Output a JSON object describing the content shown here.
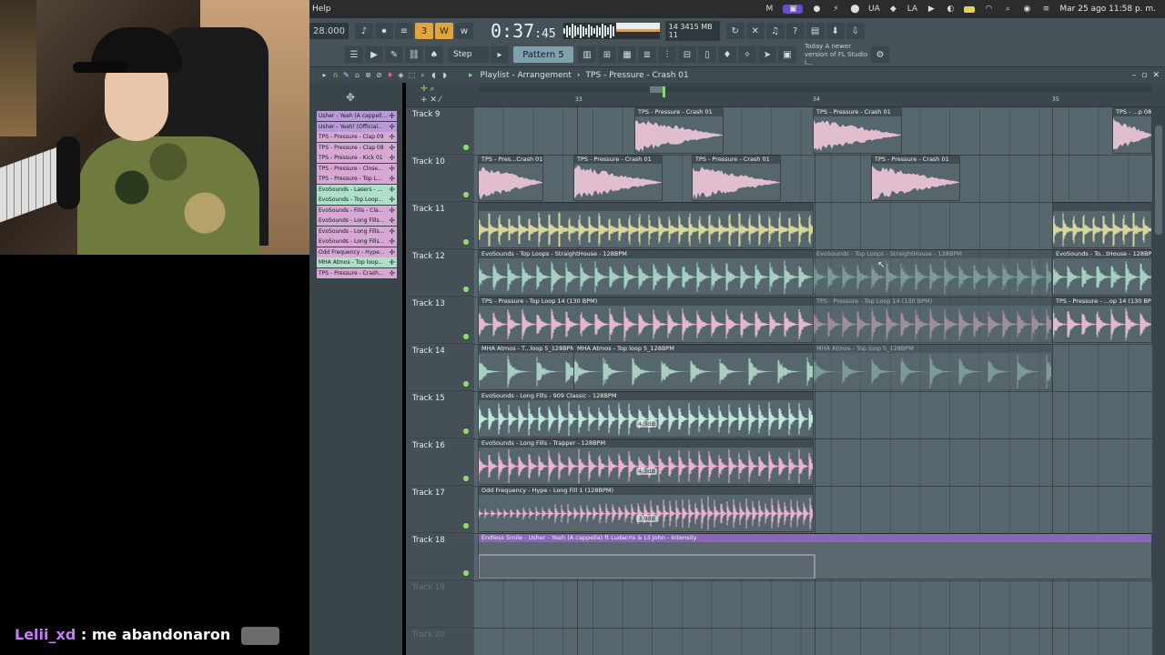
{
  "chat": {
    "user": "Lelii_xd",
    "message": ": me abandonaron"
  },
  "menubar": {
    "app_menu": "Help",
    "status_icons": [
      "M",
      "⚡",
      "●",
      "⬤",
      "UA",
      "◆",
      "LA",
      "▶",
      "◐",
      "▬",
      "wifi",
      "🔍",
      "◉",
      "≡"
    ],
    "clock": "Mar 25 ago  11:58 p. m."
  },
  "toolbar": {
    "tempo": "28.000",
    "time_main": "0:37",
    "time_sub": ":45",
    "time_unit": "M:S:CS",
    "cpu_line1": "14   3415 MB",
    "cpu_line2": "11",
    "snap_label": "Step",
    "pattern_label": "Pattern 5",
    "hint_line1": "Today  A newer",
    "hint_line2": "version of FL Studio i..."
  },
  "playlist": {
    "title": "Playlist - Arrangement",
    "separator": "›",
    "selected_clip": "TPS - Pressure - Crash 01",
    "ruler_numbers": [
      "33",
      "34",
      "35"
    ]
  },
  "picker_items": [
    {
      "label": "Usher - Yeah (A cappell...",
      "color": "#b89bd6"
    },
    {
      "label": "Usher - Yeah! (Official...",
      "color": "#b89bd6"
    },
    {
      "label": "TPS - Pressure - Clap 09",
      "color": "#d7a8d3"
    },
    {
      "label": "TPS - Pressure - Clap 08",
      "color": "#d7a8d3"
    },
    {
      "label": "TPS - Pressure - Kick 01",
      "color": "#d7a8d3"
    },
    {
      "label": "TPS - Pressure - Close...",
      "color": "#d7a8d3"
    },
    {
      "label": "TPS - Pressure - Top L...",
      "color": "#d7a8d3"
    },
    {
      "label": "EvoSounds - Lasers - ...",
      "color": "#aee0c9"
    },
    {
      "label": "EvoSounds - Top Loop...",
      "color": "#aee0c9"
    },
    {
      "label": "EvoSounds - Fills - Cla...",
      "color": "#d7a8d3"
    },
    {
      "label": "EvoSounds - Long Fills...",
      "color": "#d7a8d3"
    },
    {
      "label": "EvoSounds - Long Fills...",
      "color": "#d7a8d3"
    },
    {
      "label": "EvoSounds - Long Fills...",
      "color": "#d7a8d3"
    },
    {
      "label": "Odd Frequency - Hype...",
      "color": "#d7a8d3"
    },
    {
      "label": "MHA Atmos - Top loop...",
      "color": "#aee0c9"
    },
    {
      "label": "TPS - Pressure - Crash...",
      "color": "#d7a8d3"
    }
  ],
  "tracks": [
    {
      "name": "Track 9",
      "dim": false
    },
    {
      "name": "Track 10",
      "dim": false
    },
    {
      "name": "Track 11",
      "dim": false
    },
    {
      "name": "Track 12",
      "dim": false
    },
    {
      "name": "Track 13",
      "dim": false
    },
    {
      "name": "Track 14",
      "dim": false
    },
    {
      "name": "Track 15",
      "dim": false
    },
    {
      "name": "Track 16",
      "dim": false
    },
    {
      "name": "Track 17",
      "dim": false
    },
    {
      "name": "Track 18",
      "dim": false
    },
    {
      "name": "Track 19",
      "dim": true
    },
    {
      "name": "Track 20",
      "dim": true
    }
  ],
  "clips": [
    {
      "label": "TPS - Pressure - Crash 01",
      "color": "#e9c3d4",
      "style": "crash",
      "ghost": false,
      "db": ""
    },
    {
      "label": "TPS - Pressure - Crash 01",
      "color": "#e9c3d4",
      "style": "crash",
      "ghost": false,
      "db": ""
    },
    {
      "label": "TPS - ...p 08",
      "color": "#e9c3d4",
      "style": "crash",
      "ghost": false,
      "db": ""
    },
    {
      "label": "TPS - Pres...Crash 01",
      "color": "#e9c3d4",
      "style": "crash",
      "ghost": false,
      "db": ""
    },
    {
      "label": "TPS - Pressure - Crash 01",
      "color": "#e9c3d4",
      "style": "crash",
      "ghost": false,
      "db": ""
    },
    {
      "label": "TPS - Pressure - Crash 01",
      "color": "#e9c3d4",
      "style": "crash",
      "ghost": false,
      "db": ""
    },
    {
      "label": "TPS - Pressure - Crash 01",
      "color": "#e9c3d4",
      "style": "crash",
      "ghost": false,
      "db": ""
    },
    {
      "label": "",
      "color": "#d6d59a",
      "style": "dense-light",
      "ghost": false,
      "db": ""
    },
    {
      "label": "",
      "color": "#d6d59a",
      "style": "dense-light",
      "ghost": false,
      "db": ""
    },
    {
      "label": "EvoSounds - Top Loops - StraightHouse - 128BPM",
      "color": "#a7cfc0",
      "style": "loop",
      "ghost": false,
      "db": ""
    },
    {
      "label": "EvoSounds - Top Loops - StraightHouse - 128BPM",
      "color": "#a7cfc0",
      "style": "loop",
      "ghost": true,
      "db": ""
    },
    {
      "label": "EvoSounds - To...tHouse - 128BPM",
      "color": "#a7cfc0",
      "style": "loop",
      "ghost": false,
      "db": ""
    },
    {
      "label": "TPS - Pressure - Top Loop 14 (130 BPM)",
      "color": "#e3b9c9",
      "style": "loop",
      "ghost": false,
      "db": ""
    },
    {
      "label": "TPS - Pressure - Top Loop 14 (130 BPM)",
      "color": "#e3b9c9",
      "style": "loop",
      "ghost": true,
      "db": ""
    },
    {
      "label": "TPS - Pressure - ...op 14 (130 BPM)",
      "color": "#e3b9c9",
      "style": "loop",
      "ghost": false,
      "db": ""
    },
    {
      "label": "MHA Atmos - T...loop 5_128BPM",
      "color": "#a7cfc0",
      "style": "sparse",
      "ghost": false,
      "db": ""
    },
    {
      "label": "MHA Atmos - Top loop 5_128BPM",
      "color": "#a7cfc0",
      "style": "sparse",
      "ghost": false,
      "db": ""
    },
    {
      "label": "MHA Atmos - Top loop 5_128BPM",
      "color": "#a7cfc0",
      "style": "sparse",
      "ghost": true,
      "db": ""
    },
    {
      "label": "EvoSounds - Long Fills - 909 Classic - 128BPM",
      "color": "#bfe8dc",
      "style": "dense",
      "ghost": false,
      "db": "4.3dB"
    },
    {
      "label": "EvoSounds - Long Fills - Trapper - 128BPM",
      "color": "#e9b3cf",
      "style": "dense",
      "ghost": false,
      "db": "4.3dB"
    },
    {
      "label": "Odd Frequency - Hype - Long Fill 1 (128BPM)",
      "color": "#e9b3cf",
      "style": "ramp",
      "ghost": false,
      "db": "3.9dB"
    },
    {
      "label": "Endless Smile - Usher - Yeah (A cappella) ft Ludacris & Lil John - Intensity",
      "color": "#8a66b8",
      "style": "auto",
      "ghost": false,
      "db": ""
    }
  ]
}
